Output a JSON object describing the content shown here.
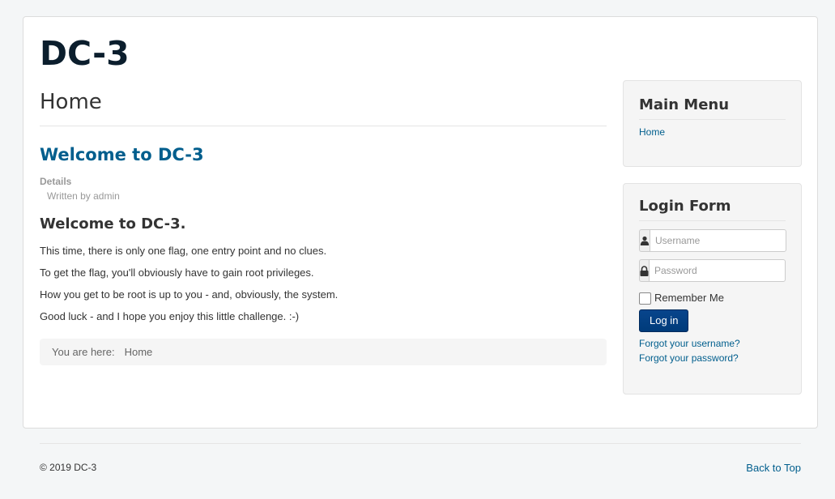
{
  "site": {
    "title": "DC-3"
  },
  "page": {
    "title": "Home"
  },
  "article": {
    "title": "Welcome to DC-3",
    "details_label": "Details",
    "written_by": "Written by admin",
    "heading": "Welcome to DC-3.",
    "paragraphs": [
      "This time, there is only one flag, one entry point and no clues.",
      "To get the flag, you'll obviously have to gain root privileges.",
      "How you get to be root is up to you - and, obviously, the system.",
      "Good luck - and I hope you enjoy this little challenge.  :-)"
    ]
  },
  "breadcrumb": {
    "prefix": "You are here:",
    "items": [
      "Home"
    ]
  },
  "main_menu": {
    "title": "Main Menu",
    "items": [
      "Home"
    ]
  },
  "login": {
    "title": "Login Form",
    "username_placeholder": "Username",
    "password_placeholder": "Password",
    "username_icon": "user-icon",
    "password_icon": "lock-icon",
    "remember_label": "Remember Me",
    "submit_label": "Log in",
    "forgot_username": "Forgot your username?",
    "forgot_password": "Forgot your password?"
  },
  "footer": {
    "copyright": "© 2019 DC-3",
    "back_to_top": "Back to Top"
  },
  "colors": {
    "link": "#005e8d",
    "title": "#0b1e2d",
    "button": "#08458c",
    "background": "#f4f6f7"
  }
}
